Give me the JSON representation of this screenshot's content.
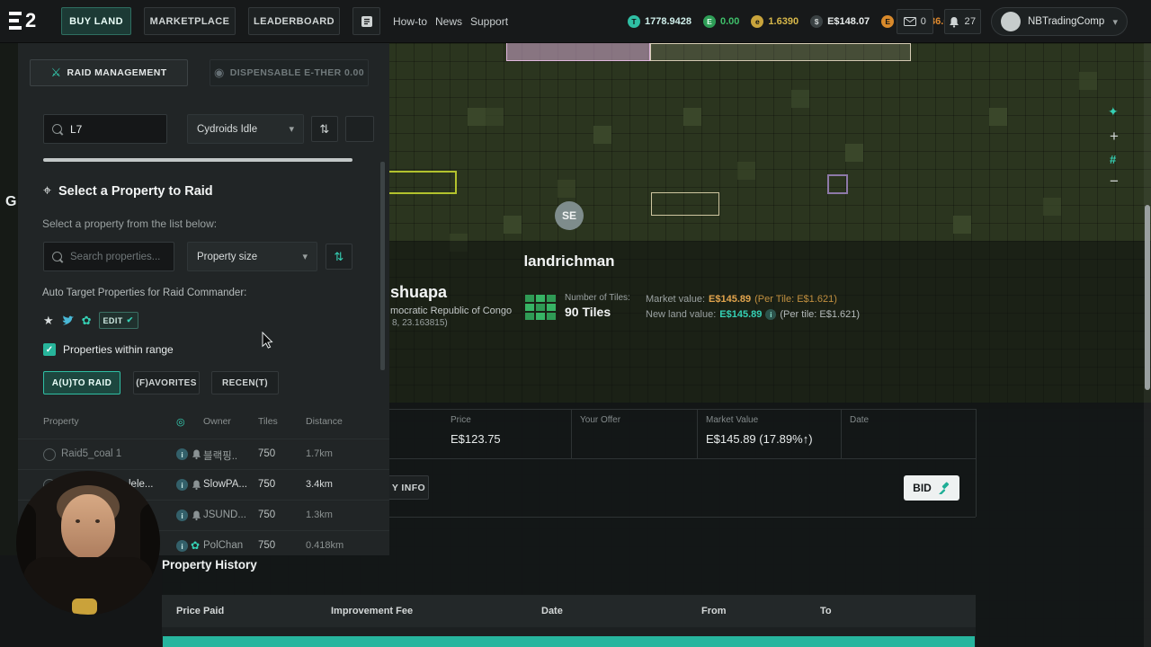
{
  "colors": {
    "accent_teal": "#2fbfa4",
    "gold": "#e2a44d",
    "orange": "#d98a2b",
    "green": "#2e9e57"
  },
  "topbar": {
    "logo": "2",
    "nav": [
      {
        "label": "BUY LAND"
      },
      {
        "label": "MARKETPLACE"
      },
      {
        "label": "LEADERBOARD"
      }
    ],
    "links": [
      "How-to",
      "News",
      "Support"
    ],
    "currencies": [
      {
        "name": "tokens",
        "icon": "T",
        "value": "1778.9428"
      },
      {
        "name": "essence",
        "icon": "E",
        "value": "0.00"
      },
      {
        "name": "ether",
        "icon": "e",
        "value": "1.6390"
      },
      {
        "name": "edollars",
        "icon": "$",
        "value": "E$148.07"
      },
      {
        "name": "pending",
        "icon": "E",
        "value": "E$55,736.05"
      }
    ],
    "mail_count": "0",
    "bell_count": "27",
    "user": "NBTradingComp..."
  },
  "sidebar": {
    "raid_btn": "RAID MANAGEMENT",
    "dispensable_btn": "DISPENSABLE E-THER 0.00",
    "search_value": "L7",
    "filter_dropdown": "Cydroids Idle",
    "heading": "Select a Property to Raid",
    "subheading": "Select a property from the list below:",
    "search_placeholder": "Search properties...",
    "size_dropdown": "Property size",
    "auto_target_label": "Auto Target Properties for Raid Commander:",
    "edit_label": "EDIT",
    "range_label": "Properties within range",
    "tabs": [
      {
        "label": "A(U)TO RAID"
      },
      {
        "label": "(F)AVORITES"
      },
      {
        "label": "RECEN(T)"
      }
    ],
    "table": {
      "property": "Property",
      "owner": "Owner",
      "tiles": "Tiles",
      "distance": "Distance"
    },
    "rows": [
      {
        "name": "Raid5_coal 1",
        "owner": "블랙핑..",
        "tiles": "750",
        "distance": "1.7km"
      },
      {
        "name": "lele...",
        "owner": "SlowPA...",
        "tiles": "750",
        "distance": "3.4km"
      },
      {
        "name": "",
        "owner": "JSUND...",
        "tiles": "750",
        "distance": "1.3km"
      },
      {
        "name": "",
        "owner": "PolChan",
        "tiles": "750",
        "distance": "0.418km"
      }
    ]
  },
  "property": {
    "seller_initials": "SE",
    "owner": "landrichman",
    "name_fragment": "shuapa",
    "country_fragment": "mocratic Republic of Congo",
    "coords_fragment": "8, 23.163815)",
    "tiles_label": "Number of Tiles:",
    "tiles_value": "90 Tiles",
    "market_label": "Market value:",
    "market_value": "E$145.89",
    "market_pertile": "(Per Tile: E$1.621)",
    "newland_label": "New land value:",
    "newland_value": "E$145.89",
    "newland_pertile": "(Per tile: E$1.621)"
  },
  "bid": {
    "price_label": "Price",
    "price_value": "E$123.75",
    "offer_label": "Your Offer",
    "market_label": "Market Value",
    "market_value": "E$145.89 (17.89%↑)",
    "date_label": "Date",
    "info_btn_fragment": "Y INFO",
    "bid_btn": "BID"
  },
  "history": {
    "title": "Property History",
    "headers": [
      "Price Paid",
      "Improvement Fee",
      "Date",
      "From",
      "To"
    ]
  },
  "map": {
    "label_fragment": "G",
    "controls": {
      "zoom_in": "+",
      "grid": "#",
      "zoom_out": "−"
    }
  }
}
